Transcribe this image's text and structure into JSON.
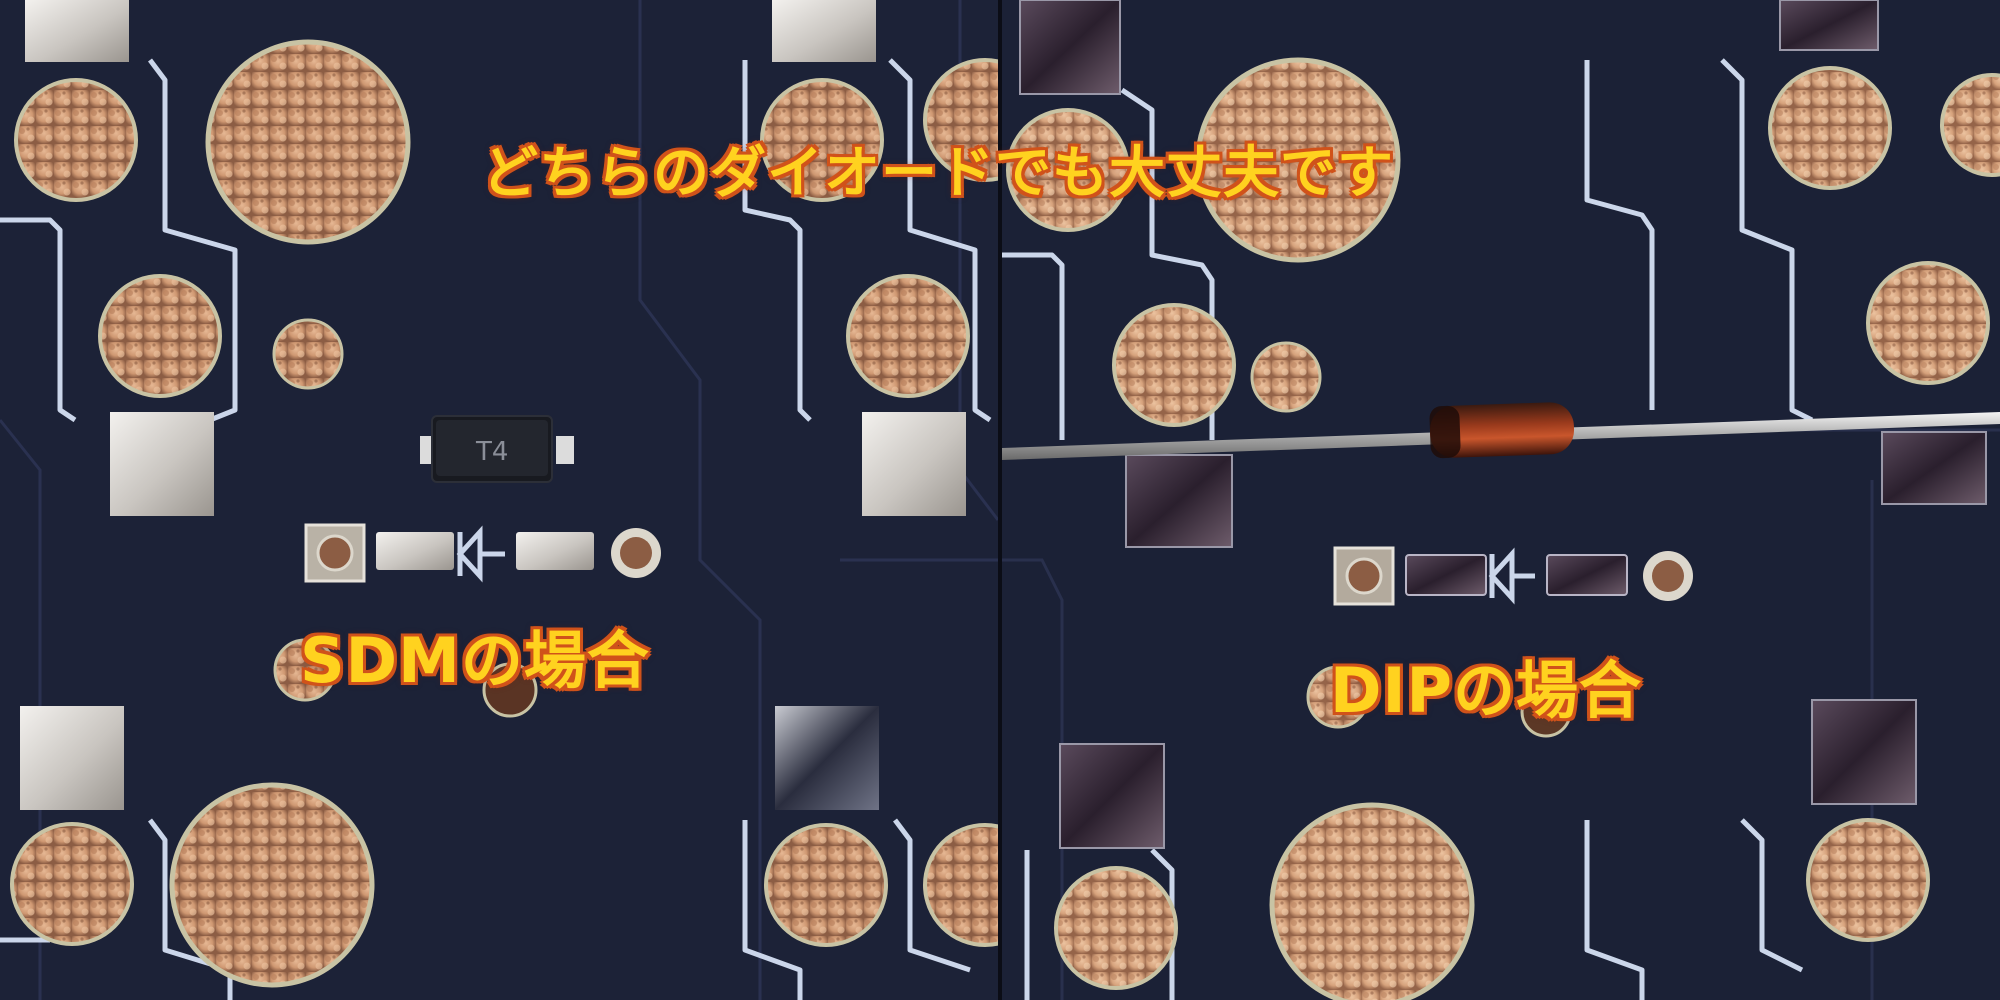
{
  "captions": {
    "title": "どちらのダイオードでも大丈夫です",
    "smd": "SDMの場合",
    "dip": "DIPの場合"
  },
  "component_marking": "T4",
  "colors": {
    "board": "#1c2237",
    "trace": "#cbd6ea",
    "caption_fill": "#ffd21f",
    "caption_outline": "#d0521a",
    "cork": "#d9a57c",
    "diode_body": "#7a2a18"
  }
}
